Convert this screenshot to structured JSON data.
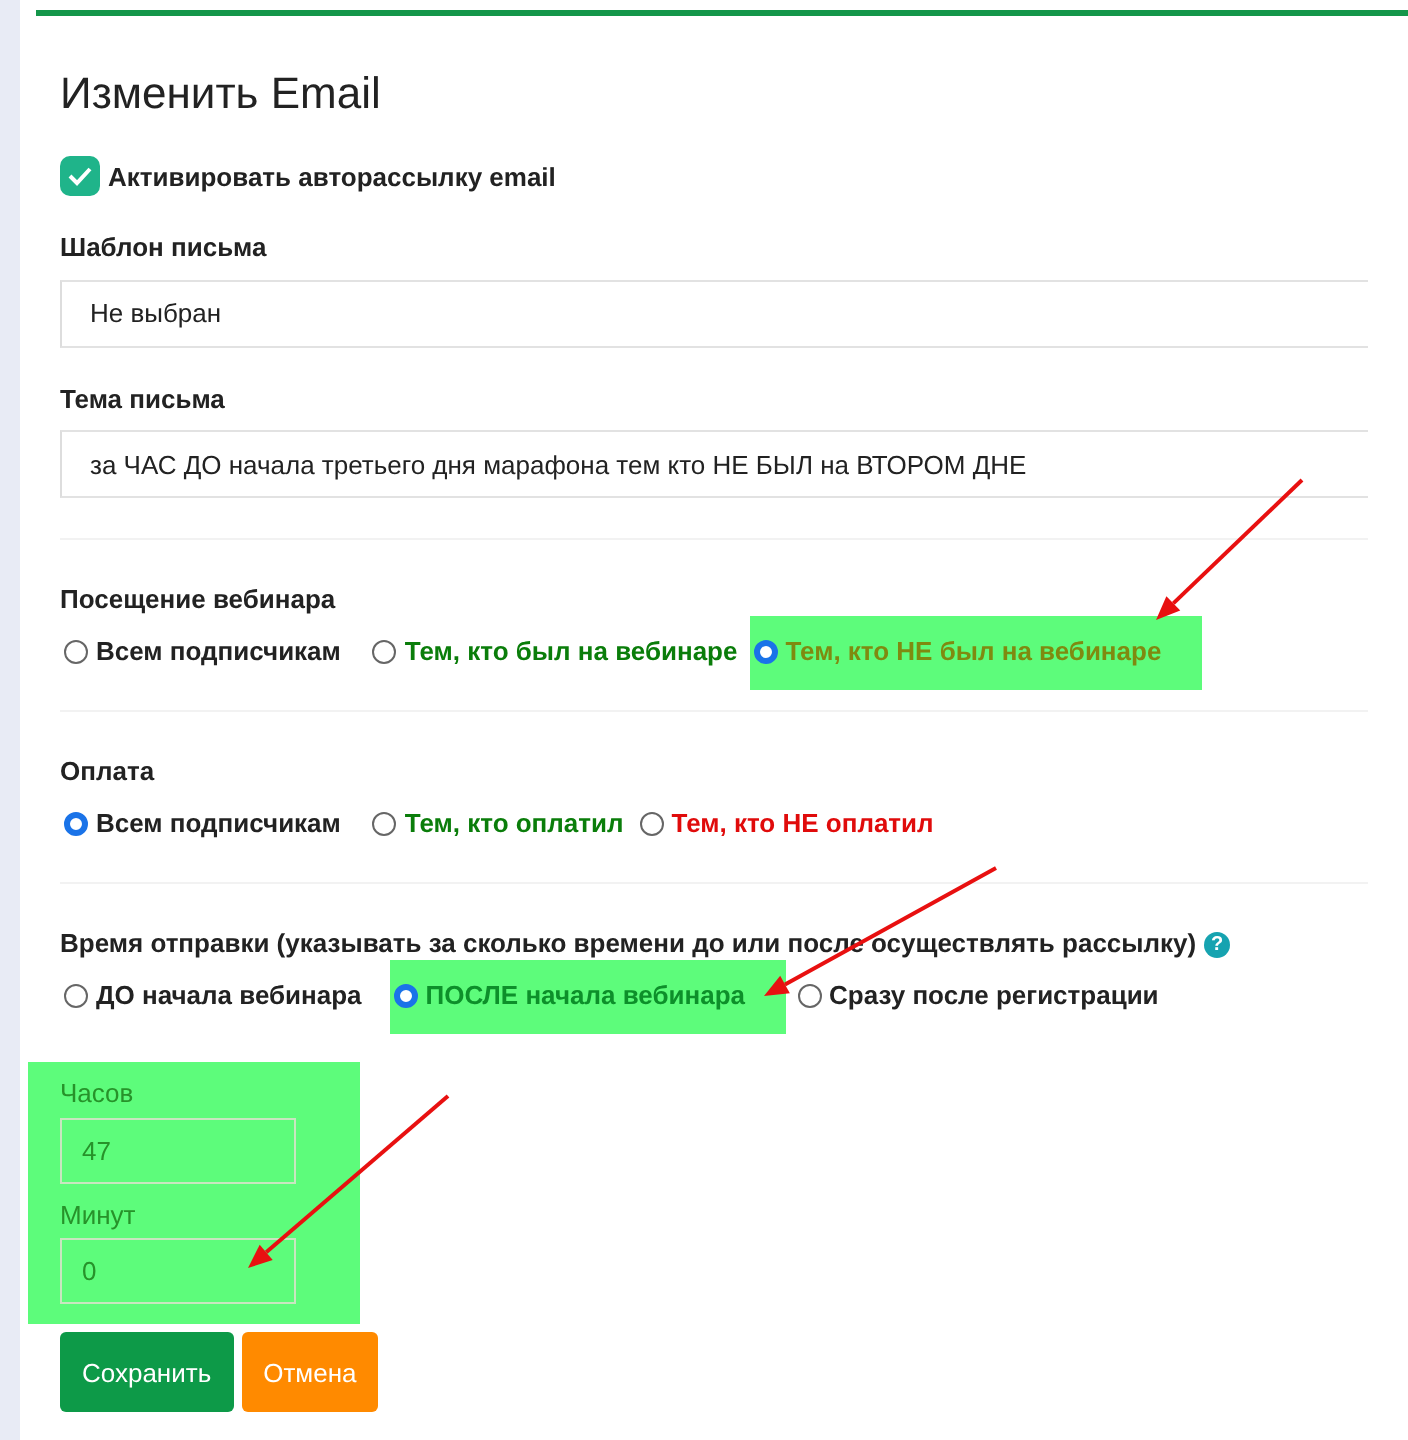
{
  "title": "Изменить Email",
  "activate": {
    "label": "Активировать авторассылку email",
    "checked": true
  },
  "template": {
    "label": "Шаблон письма",
    "value": "Не выбран"
  },
  "subject": {
    "label": "Тема письма",
    "value": "за ЧАС ДО начала третьего дня марафона тем кто НЕ БЫЛ на ВТОРОМ ДНЕ"
  },
  "groups": [
    {
      "label": "Посещение вебинара",
      "options": [
        {
          "label": "Всем подписчикам",
          "selected": false,
          "highlighted": false,
          "color": "#222222"
        },
        {
          "label": "Тем, кто был на вебинаре",
          "selected": false,
          "highlighted": false,
          "color": "#0a7d0a"
        },
        {
          "label": "Тем, кто НЕ был на вебинаре",
          "selected": true,
          "highlighted": true,
          "color": "#7f8a10"
        }
      ]
    },
    {
      "label": "Оплата",
      "options": [
        {
          "label": "Всем подписчикам",
          "selected": true,
          "highlighted": false,
          "color": "#222222"
        },
        {
          "label": "Тем, кто оплатил",
          "selected": false,
          "highlighted": false,
          "color": "#0a7d0a"
        },
        {
          "label": "Тем, кто НЕ оплатил",
          "selected": false,
          "highlighted": false,
          "color": "#e00b0b"
        }
      ]
    },
    {
      "label": "Время отправки (указывать за сколько времени до или после осуществлять рассылку)",
      "help": "?",
      "options": [
        {
          "label": "ДО начала вебинара",
          "selected": false,
          "highlighted": false,
          "color": "#222222"
        },
        {
          "label": "ПОСЛЕ начала вебинара",
          "selected": true,
          "highlighted": true,
          "color": "#0d8f2a"
        },
        {
          "label": "Сразу после регистрации",
          "selected": false,
          "highlighted": false,
          "color": "#222222"
        }
      ]
    }
  ],
  "delay": {
    "highlighted": true,
    "fields": [
      {
        "label": "Часов",
        "value": "47"
      },
      {
        "label": "Минут",
        "value": "0"
      }
    ]
  },
  "buttons": [
    {
      "label": "Сохранить",
      "kind": "primary"
    },
    {
      "label": "Отмена",
      "kind": "cancel"
    }
  ]
}
